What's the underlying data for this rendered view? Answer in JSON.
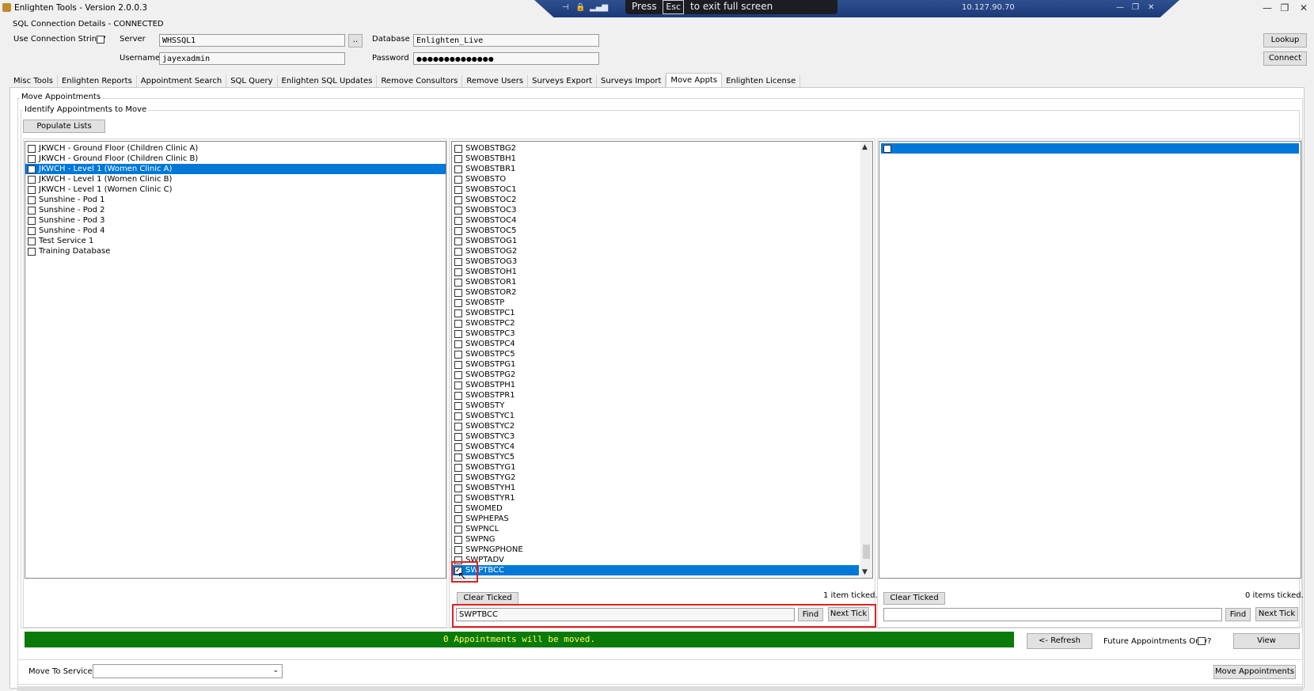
{
  "window": {
    "title": "Enlighten Tools - Version 2.0.0.3",
    "minimize": "—",
    "restore": "❐",
    "close": "✕"
  },
  "remote_bar": {
    "address": "10.127.90.70",
    "esc_hint_prefix": "Press",
    "esc_key": "Esc",
    "esc_hint_suffix": "to exit full screen"
  },
  "connection": {
    "status": "SQL Connection Details - CONNECTED",
    "use_conn_string_label": "Use Connection String?",
    "server_label": "Server",
    "server_value": "WHSSQL1",
    "browse_label": "..",
    "database_label": "Database",
    "database_value": "Enlighten_Live",
    "username_label": "Username",
    "username_value": "jayexadmin",
    "password_label": "Password",
    "password_value": "●●●●●●●●●●●●●●",
    "lookup_label": "Lookup",
    "connect_label": "Connect"
  },
  "tabs": [
    {
      "label": "Misc Tools"
    },
    {
      "label": "Enlighten Reports"
    },
    {
      "label": "Appointment Search"
    },
    {
      "label": "SQL Query"
    },
    {
      "label": "Enlighten SQL Updates"
    },
    {
      "label": "Remove Consultors"
    },
    {
      "label": "Remove Users"
    },
    {
      "label": "Surveys Export"
    },
    {
      "label": "Surveys Import"
    },
    {
      "label": "Move Appts"
    },
    {
      "label": "Enlighten License"
    }
  ],
  "active_tab": "Move Appts",
  "move": {
    "group_title": "Move Appointments",
    "identify_title": "Identify Appointments to Move",
    "populate_label": "Populate Lists",
    "services": [
      {
        "label": "JKWCH - Ground Floor (Children Clinic A)",
        "selected": false
      },
      {
        "label": "JKWCH - Ground Floor (Children Clinic B)",
        "selected": false
      },
      {
        "label": "JKWCH - Level 1 (Women Clinic A)",
        "selected": true
      },
      {
        "label": "JKWCH - Level 1 (Women Clinic B)",
        "selected": false
      },
      {
        "label": "JKWCH - Level 1 (Women Clinic C)",
        "selected": false
      },
      {
        "label": "Sunshine - Pod 1",
        "selected": false
      },
      {
        "label": "Sunshine - Pod 2",
        "selected": false
      },
      {
        "label": "Sunshine - Pod 3",
        "selected": false
      },
      {
        "label": "Sunshine - Pod 4",
        "selected": false
      },
      {
        "label": "Test Service 1",
        "selected": false
      },
      {
        "label": "Training Database",
        "selected": false
      }
    ],
    "clinics": [
      "SWOBSTBG2",
      "SWOBSTBH1",
      "SWOBSTBR1",
      "SWOBSTO",
      "SWOBSTOC1",
      "SWOBSTOC2",
      "SWOBSTOC3",
      "SWOBSTOC4",
      "SWOBSTOC5",
      "SWOBSTOG1",
      "SWOBSTOG2",
      "SWOBSTOG3",
      "SWOBSTOH1",
      "SWOBSTOR1",
      "SWOBSTOR2",
      "SWOBSTP",
      "SWOBSTPC1",
      "SWOBSTPC2",
      "SWOBSTPC3",
      "SWOBSTPC4",
      "SWOBSTPC5",
      "SWOBSTPG1",
      "SWOBSTPG2",
      "SWOBSTPH1",
      "SWOBSTPR1",
      "SWOBSTY",
      "SWOBSTYC1",
      "SWOBSTYC2",
      "SWOBSTYC3",
      "SWOBSTYC4",
      "SWOBSTYC5",
      "SWOBSTYG1",
      "SWOBSTYG2",
      "SWOBSTYH1",
      "SWOBSTYR1",
      "SWOMED",
      "SWPHEPAS",
      "SWPNCL",
      "SWPNG",
      "SWPNGPHONE",
      "SWPTADV",
      "SWPTBCC"
    ],
    "clinic_selected_index": 41,
    "clinic_scroll_fraction": 0.98,
    "clear_ticked_label": "Clear Ticked",
    "clinic_ticked_text": "1 item ticked.",
    "clinic_search_value": "SWPTBCC",
    "find_label": "Find",
    "next_tick_label": "Next Tick",
    "slots_ticked_text": "0 items ticked.",
    "slots_search_value": "",
    "status_message": "0 Appointments will be moved.",
    "refresh_label": "<- Refresh",
    "future_only_label": "Future Appointments Only?",
    "view_label": "View",
    "move_to_label": "Move To Service",
    "move_to_value": "",
    "move_button_label": "Move Appointments"
  }
}
